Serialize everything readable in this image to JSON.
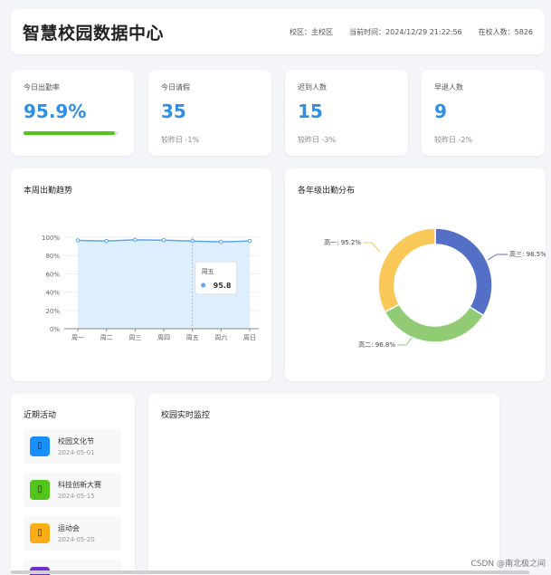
{
  "header": {
    "title": "智慧校园数据中心",
    "campus": "校区：主校区",
    "time": "当前时间：2024/12/29 21:22:56",
    "students": "在校人数：5826"
  },
  "stats": [
    {
      "label": "今日出勤率",
      "value": "95.9%",
      "progress": 0.959,
      "color": "#52c41a"
    },
    {
      "label": "今日请假",
      "value": "35",
      "sub": "较昨日 -1%"
    },
    {
      "label": "迟到人数",
      "value": "15",
      "sub": "较昨日 -3%"
    },
    {
      "label": "早退人数",
      "value": "9",
      "sub": "较昨日 -2%"
    }
  ],
  "trend": {
    "title": "本周出勤趋势",
    "tooltip": {
      "day": "周五",
      "value": "95.8"
    }
  },
  "distribution": {
    "title": "各年级出勤分布",
    "labels": [
      "高一: 95.2%",
      "高三: 98.5%",
      "高二: 96.8%"
    ]
  },
  "activity": {
    "title": "近期活动",
    "items": [
      {
        "name": "校园文化节",
        "date": "2024-05-01",
        "color": "#1890ff",
        "icon": "calendar-icon"
      },
      {
        "name": "科技创新大赛",
        "date": "2024-05-15",
        "color": "#52c41a",
        "icon": "trophy-icon"
      },
      {
        "name": "运动会",
        "date": "2024-05-20",
        "color": "#faad14",
        "icon": "flag-icon"
      }
    ]
  },
  "monitor": {
    "title": "校园实时监控"
  },
  "watermark": "CSDN @南北极之间",
  "chart_data": [
    {
      "type": "area",
      "title": "本周出勤趋势",
      "categories": [
        "周一",
        "周二",
        "周三",
        "周四",
        "周五",
        "周六",
        "周日"
      ],
      "values": [
        96.5,
        95.9,
        97.2,
        96.8,
        95.8,
        94.9,
        95.9
      ],
      "y_ticks": [
        "0%",
        "20%",
        "40%",
        "60%",
        "80%",
        "100%"
      ],
      "ylim": [
        0,
        100
      ],
      "color": "#5aa8ee"
    },
    {
      "type": "pie",
      "title": "各年级出勤分布",
      "categories": [
        "高三",
        "高二",
        "高一"
      ],
      "values": [
        98.5,
        96.8,
        95.2
      ],
      "colors": [
        "#5470c6",
        "#91cc75",
        "#fac858"
      ]
    }
  ]
}
